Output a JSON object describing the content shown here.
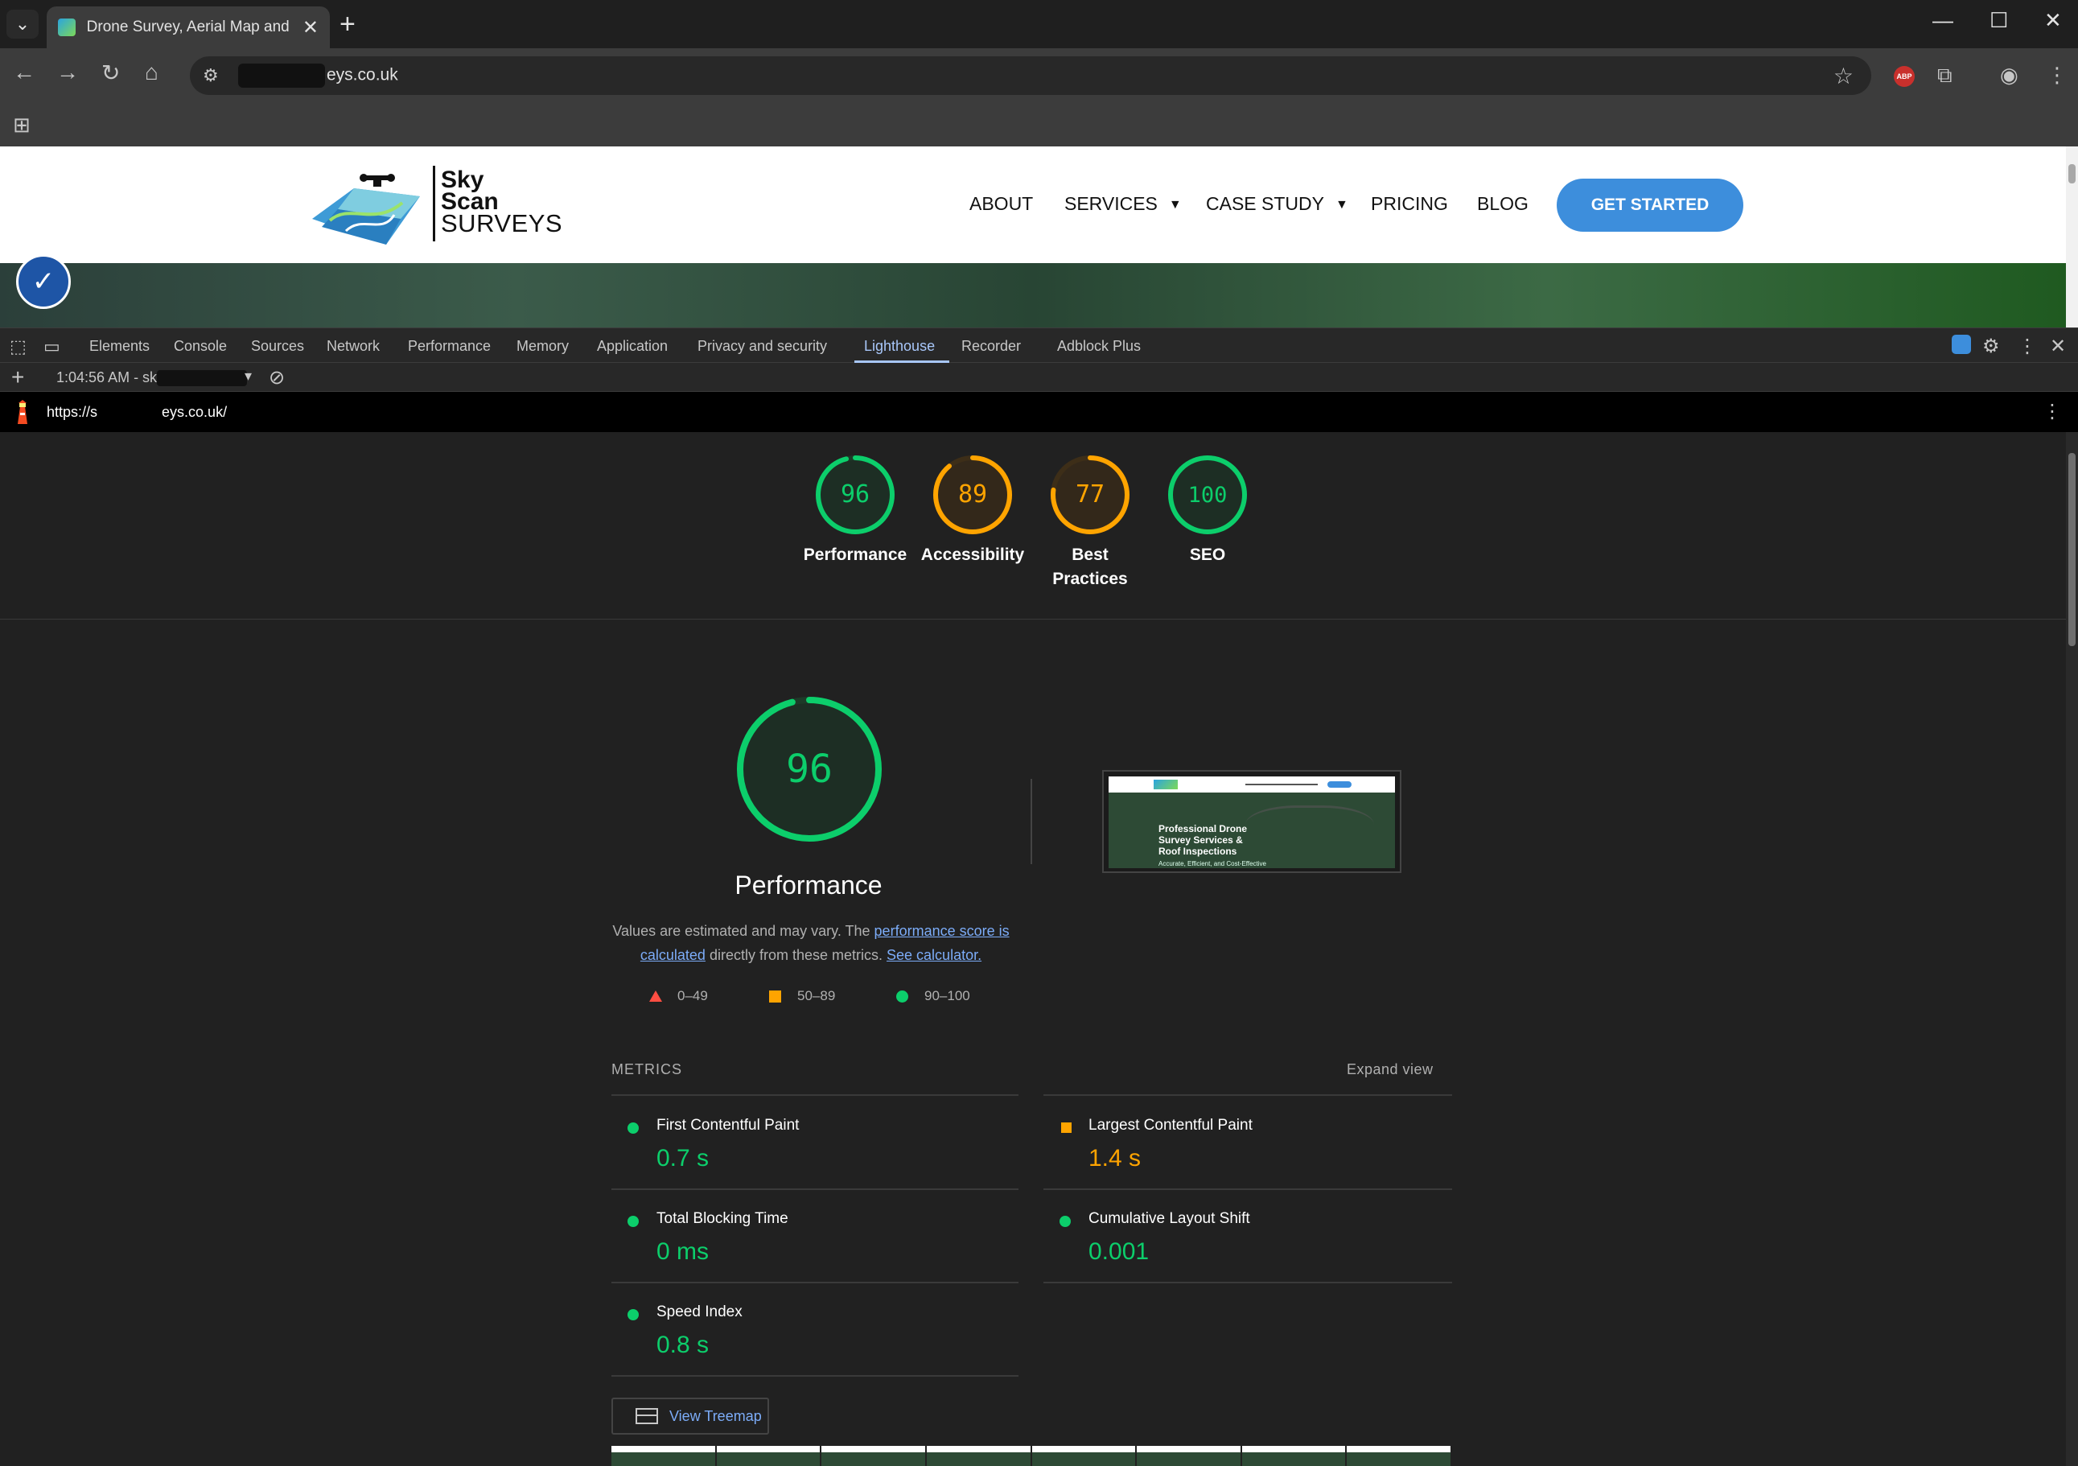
{
  "browser": {
    "tab_title": "Drone Survey, Aerial Map and I",
    "url_suffix": "eys.co.uk"
  },
  "site": {
    "logo": {
      "line1": "Sky",
      "line2": "Scan",
      "line3": "SURVEYS"
    },
    "nav": {
      "about": "ABOUT",
      "services": "SERVICES",
      "case_study": "CASE STUDY",
      "pricing": "PRICING",
      "blog": "BLOG",
      "cta": "GET STARTED"
    },
    "thumbnail": {
      "headline_1": "Professional Drone",
      "headline_2": "Survey Services &",
      "headline_3": "Roof Inspections",
      "sub": "Accurate, Efficient, and Cost-Effective"
    }
  },
  "devtools": {
    "tabs": [
      "Elements",
      "Console",
      "Sources",
      "Network",
      "Performance",
      "Memory",
      "Application",
      "Privacy and security",
      "Lighthouse",
      "Recorder",
      "Adblock Plus"
    ],
    "active_tab": "Lighthouse",
    "report_selector": "1:04:56 AM - sk",
    "report_url_prefix": "https://s",
    "report_url_suffix": "eys.co.uk/"
  },
  "lighthouse": {
    "scores": [
      {
        "label": "Performance",
        "value": 96,
        "color": "#0cce6b"
      },
      {
        "label": "Accessibility",
        "value": 89,
        "color": "#ffa400"
      },
      {
        "label": "Best Practices",
        "value": 77,
        "color": "#ffa400"
      },
      {
        "label": "SEO",
        "value": 100,
        "color": "#0cce6b"
      }
    ],
    "performance": {
      "score": 96,
      "title": "Performance",
      "desc_1": "Values are estimated and may vary. The ",
      "desc_link_1": "performance score is calculated",
      "desc_2": " directly from these metrics. ",
      "desc_link_2": "See calculator."
    },
    "legend": [
      {
        "range": "0–49",
        "color": "#ff4e42"
      },
      {
        "range": "50–89",
        "color": "#ffa400"
      },
      {
        "range": "90–100",
        "color": "#0cce6b"
      }
    ],
    "metrics_title": "METRICS",
    "expand_view": "Expand view",
    "metrics": [
      {
        "name": "First Contentful Paint",
        "value": "0.7 s",
        "status": "green"
      },
      {
        "name": "Largest Contentful Paint",
        "value": "1.4 s",
        "status": "orange"
      },
      {
        "name": "Total Blocking Time",
        "value": "0 ms",
        "status": "green"
      },
      {
        "name": "Cumulative Layout Shift",
        "value": "0.001",
        "status": "green"
      },
      {
        "name": "Speed Index",
        "value": "0.8 s",
        "status": "green"
      }
    ],
    "treemap_button": "View Treemap"
  }
}
